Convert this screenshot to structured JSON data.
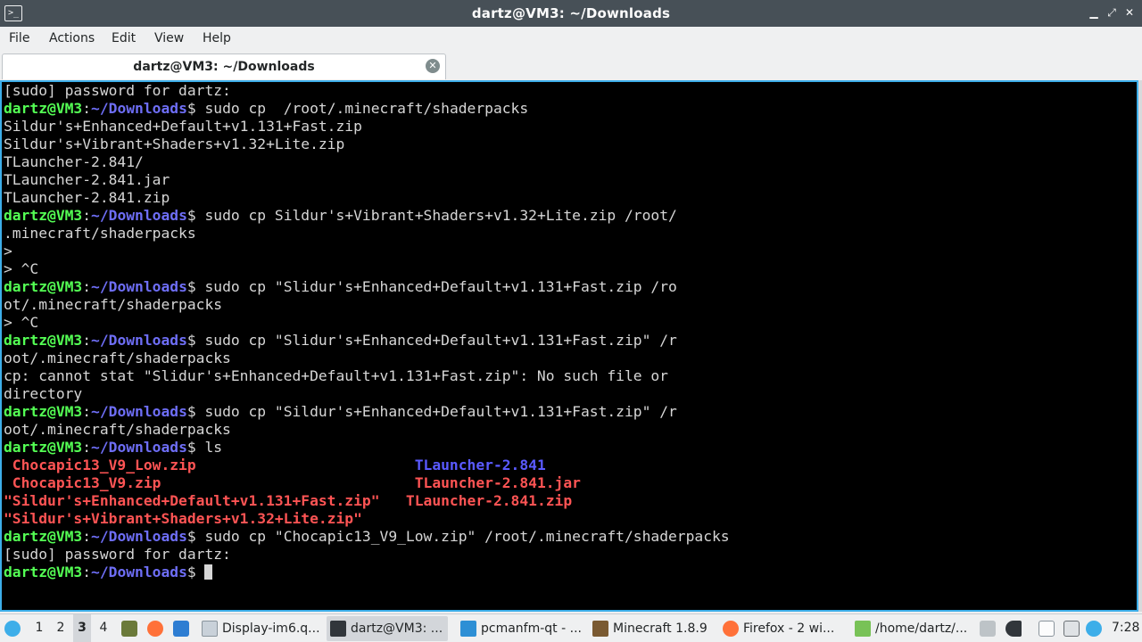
{
  "window": {
    "title": "dartz@VM3: ~/Downloads",
    "app_icon_glyph": ">_",
    "minimize_glyph": "▁",
    "maximize_glyph": "⤢",
    "close_glyph": "✕"
  },
  "menubar": {
    "file": "File",
    "actions": "Actions",
    "edit": "Edit",
    "view": "View",
    "help": "Help"
  },
  "tab": {
    "label": "dartz@VM3: ~/Downloads",
    "close_glyph": "✕"
  },
  "terminal": {
    "lines": [
      [
        {
          "t": "[sudo] password for dartz:"
        }
      ],
      [
        {
          "t": "dartz@VM3",
          "c": "u"
        },
        {
          "t": ":"
        },
        {
          "t": "~/Downloads",
          "c": "p"
        },
        {
          "t": "$ sudo cp  /root/.minecraft/shaderpacks"
        }
      ],
      [
        {
          "t": "Sildur's+Enhanced+Default+v1.131+Fast.zip"
        }
      ],
      [
        {
          "t": "Sildur's+Vibrant+Shaders+v1.32+Lite.zip"
        }
      ],
      [
        {
          "t": "TLauncher-2.841/"
        }
      ],
      [
        {
          "t": "TLauncher-2.841.jar"
        }
      ],
      [
        {
          "t": "TLauncher-2.841.zip"
        }
      ],
      [
        {
          "t": "dartz@VM3",
          "c": "u"
        },
        {
          "t": ":"
        },
        {
          "t": "~/Downloads",
          "c": "p"
        },
        {
          "t": "$ sudo cp Sildur's+Vibrant+Shaders+v1.32+Lite.zip /root/"
        }
      ],
      [
        {
          "t": ".minecraft/shaderpacks"
        }
      ],
      [
        {
          "t": ">"
        }
      ],
      [
        {
          "t": "> ^C"
        }
      ],
      [
        {
          "t": "dartz@VM3",
          "c": "u"
        },
        {
          "t": ":"
        },
        {
          "t": "~/Downloads",
          "c": "p"
        },
        {
          "t": "$ sudo cp \"Slidur's+Enhanced+Default+v1.131+Fast.zip /ro"
        }
      ],
      [
        {
          "t": "ot/.minecraft/shaderpacks"
        }
      ],
      [
        {
          "t": "> ^C"
        }
      ],
      [
        {
          "t": "dartz@VM3",
          "c": "u"
        },
        {
          "t": ":"
        },
        {
          "t": "~/Downloads",
          "c": "p"
        },
        {
          "t": "$ sudo cp \"Slidur's+Enhanced+Default+v1.131+Fast.zip\" /r"
        }
      ],
      [
        {
          "t": "oot/.minecraft/shaderpacks"
        }
      ],
      [
        {
          "t": "cp: cannot stat \"Slidur's+Enhanced+Default+v1.131+Fast.zip\": No such file or"
        }
      ],
      [
        {
          "t": "directory"
        }
      ],
      [
        {
          "t": "dartz@VM3",
          "c": "u"
        },
        {
          "t": ":"
        },
        {
          "t": "~/Downloads",
          "c": "p"
        },
        {
          "t": "$ sudo cp \"Sildur's+Enhanced+Default+v1.131+Fast.zip\" /r"
        }
      ],
      [
        {
          "t": "oot/.minecraft/shaderpacks"
        }
      ],
      [
        {
          "t": "dartz@VM3",
          "c": "u"
        },
        {
          "t": ":"
        },
        {
          "t": "~/Downloads",
          "c": "p"
        },
        {
          "t": "$ ls"
        }
      ],
      [
        {
          "t": " Chocapic13_V9_Low.zip",
          "c": "r"
        },
        {
          "t": "                         "
        },
        {
          "t": "TLauncher-2.841",
          "c": "d"
        }
      ],
      [
        {
          "t": " Chocapic13_V9.zip",
          "c": "r"
        },
        {
          "t": "                             "
        },
        {
          "t": "TLauncher-2.841.jar",
          "c": "r"
        }
      ],
      [
        {
          "t": "\"Sildur's+Enhanced+Default+v1.131+Fast.zip\"",
          "c": "r"
        },
        {
          "t": "   "
        },
        {
          "t": "TLauncher-2.841.zip",
          "c": "r"
        }
      ],
      [
        {
          "t": "\"Sildur's+Vibrant+Shaders+v1.32+Lite.zip\"",
          "c": "r"
        }
      ],
      [
        {
          "t": "dartz@VM3",
          "c": "u"
        },
        {
          "t": ":"
        },
        {
          "t": "~/Downloads",
          "c": "p"
        },
        {
          "t": "$ sudo cp \"Chocapic13_V9_Low.zip\" /root/.minecraft/shaderpacks"
        }
      ],
      [
        {
          "t": "[sudo] password for dartz:"
        }
      ],
      [
        {
          "t": "dartz@VM3",
          "c": "u"
        },
        {
          "t": ":"
        },
        {
          "t": "~/Downloads",
          "c": "p"
        },
        {
          "t": "$ "
        },
        {
          "cursor": true
        }
      ]
    ]
  },
  "taskbar": {
    "desktops": [
      "1",
      "2",
      "3",
      "4"
    ],
    "active_desktop": "3",
    "tasks": [
      {
        "label": "Display-im6.q...",
        "icon": "image-viewer-icon"
      },
      {
        "label": "dartz@VM3: ...",
        "icon": "terminal-icon",
        "active": true
      },
      {
        "label": "pcmanfm-qt - ...",
        "icon": "folder-icon"
      },
      {
        "label": "Minecraft 1.8.9",
        "icon": "minecraft-icon"
      },
      {
        "label": "Firefox - 2 wi...",
        "icon": "firefox-icon"
      },
      {
        "label": "/home/dartz/...",
        "icon": "android-icon"
      }
    ],
    "clock": "7:28",
    "colors": {
      "accent": "#3daee9",
      "prompt_user": "#54ff54",
      "prompt_path": "#6e6ef6",
      "file_red": "#ff5454"
    }
  }
}
